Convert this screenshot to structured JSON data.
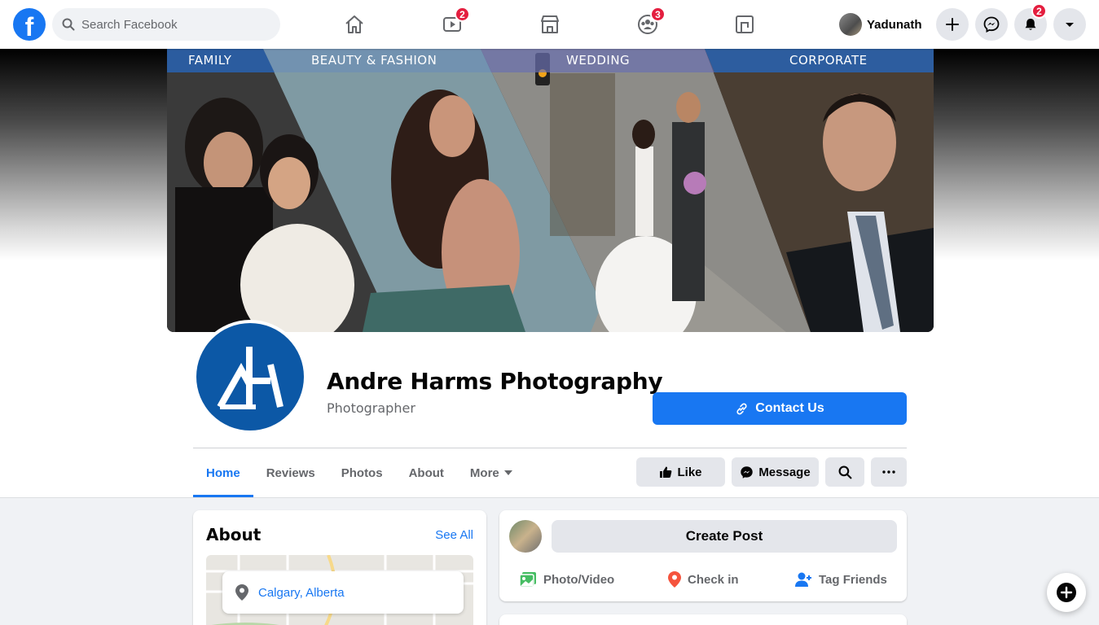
{
  "topbar": {
    "logo": "f",
    "search_placeholder": "Search Facebook",
    "nav": [
      {
        "name": "home-icon",
        "badge": ""
      },
      {
        "name": "watch-icon",
        "badge": "2"
      },
      {
        "name": "marketplace-icon",
        "badge": ""
      },
      {
        "name": "groups-icon",
        "badge": "3"
      },
      {
        "name": "gaming-icon",
        "badge": ""
      }
    ],
    "profile_name": "Yadunath",
    "notifications_badge": "2"
  },
  "cover": {
    "tabs": [
      "FAMILY",
      "BEAUTY & FASHION",
      "WEDDING",
      "CORPORATE"
    ]
  },
  "page": {
    "name": "Andre Harms Photography",
    "category": "Photographer",
    "contact_label": "Contact Us"
  },
  "tabs": [
    "Home",
    "Reviews",
    "Photos",
    "About",
    "More"
  ],
  "actions": {
    "like": "Like",
    "message": "Message"
  },
  "about": {
    "title": "About",
    "see_all": "See All",
    "location": "Calgary, Alberta"
  },
  "create_post": {
    "button": "Create Post",
    "photo_video": "Photo/Video",
    "check_in": "Check in",
    "tag_friends": "Tag Friends"
  },
  "colors": {
    "brand_blue": "#1877f2",
    "logo_blue": "#0c58a6",
    "badge_red": "#e41e3f"
  }
}
